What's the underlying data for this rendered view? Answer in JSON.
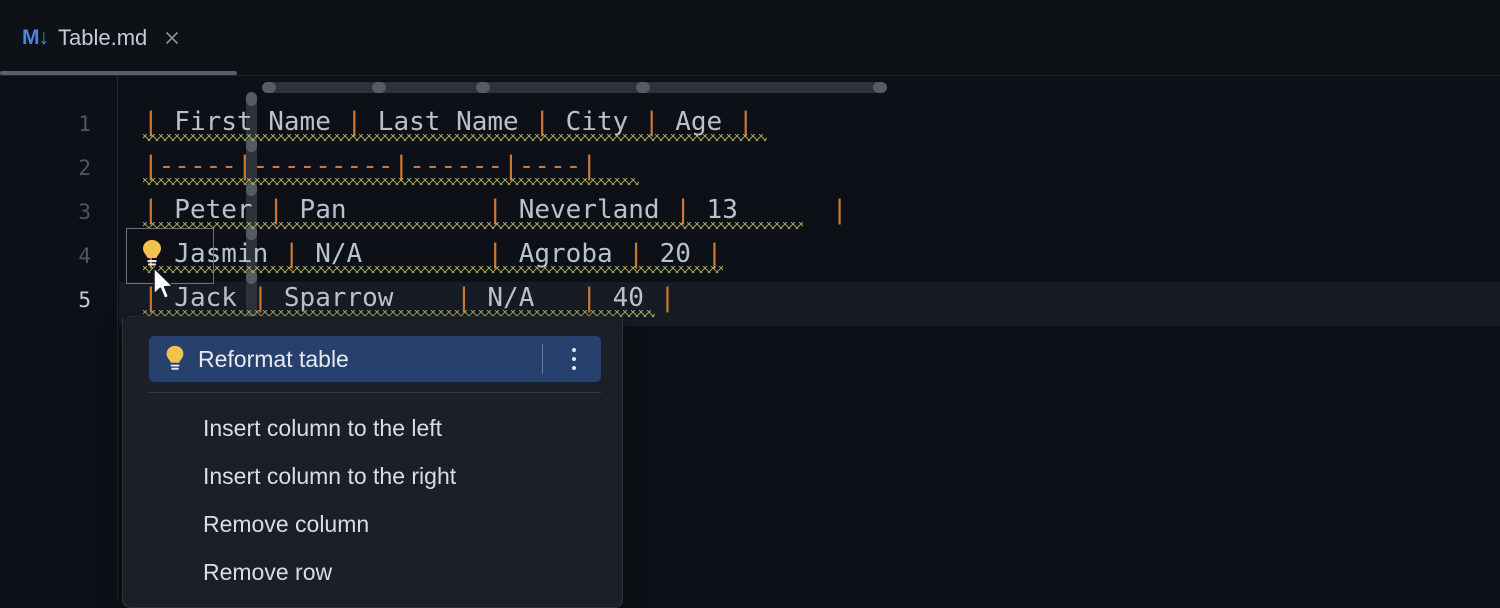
{
  "window": {
    "theme_background": "#0d1117",
    "accent_selected": "#27406e"
  },
  "tab": {
    "icon_name": "markdown-file-icon",
    "icon_glyph": "M↓",
    "title": "Table.md",
    "close_label": "×"
  },
  "editor": {
    "gutter_line_numbers": [
      "1",
      "2",
      "3",
      "4",
      "5"
    ],
    "current_line": "5",
    "lines": [
      {
        "number": "1",
        "text": "| First Name | Last Name | City | Age |",
        "tokens": [
          {
            "t": "|",
            "k": "pipe"
          },
          {
            "t": " First Name ",
            "k": "txt"
          },
          {
            "t": "|",
            "k": "pipe"
          },
          {
            "t": " Last Name ",
            "k": "txt"
          },
          {
            "t": "|",
            "k": "pipe"
          },
          {
            "t": " City ",
            "k": "txt"
          },
          {
            "t": "|",
            "k": "pipe"
          },
          {
            "t": " Age ",
            "k": "txt"
          },
          {
            "t": "|",
            "k": "pipe"
          }
        ]
      },
      {
        "number": "2",
        "text": "|-----|---------|------|----|",
        "tokens": [
          {
            "t": "|",
            "k": "pipe"
          },
          {
            "t": "-----",
            "k": "dash"
          },
          {
            "t": "|",
            "k": "pipe"
          },
          {
            "t": "---------",
            "k": "dash"
          },
          {
            "t": "|",
            "k": "pipe"
          },
          {
            "t": "------",
            "k": "dash"
          },
          {
            "t": "|",
            "k": "pipe"
          },
          {
            "t": "----",
            "k": "dash"
          },
          {
            "t": "|",
            "k": "pipe"
          }
        ]
      },
      {
        "number": "3",
        "text": "| Peter | Pan      | Neverland | 13     |",
        "tokens": [
          {
            "t": "|",
            "k": "pipe"
          },
          {
            "t": " Peter ",
            "k": "txt"
          },
          {
            "t": "|",
            "k": "pipe"
          },
          {
            "t": " Pan         ",
            "k": "txt"
          },
          {
            "t": "|",
            "k": "pipe"
          },
          {
            "t": " Neverland ",
            "k": "txt"
          },
          {
            "t": "|",
            "k": "pipe"
          },
          {
            "t": " 13      ",
            "k": "txt"
          },
          {
            "t": "|",
            "k": "pipe"
          }
        ]
      },
      {
        "number": "4",
        "text": "| Jasmin | N/A      | Agroba | 20 |",
        "tokens": [
          {
            "t": "|",
            "k": "pipe"
          },
          {
            "t": " Jasmin ",
            "k": "txt"
          },
          {
            "t": "|",
            "k": "pipe"
          },
          {
            "t": " N/A        ",
            "k": "txt"
          },
          {
            "t": "|",
            "k": "pipe"
          },
          {
            "t": " Agroba ",
            "k": "txt"
          },
          {
            "t": "|",
            "k": "pipe"
          },
          {
            "t": " 20 ",
            "k": "txt"
          },
          {
            "t": "|",
            "k": "pipe"
          }
        ]
      },
      {
        "number": "5",
        "text": "| Jack | Sparrow   | N/A   | 40 |",
        "tokens": [
          {
            "t": "|",
            "k": "pipe"
          },
          {
            "t": " Jack ",
            "k": "txt"
          },
          {
            "t": "|",
            "k": "pipe"
          },
          {
            "t": " Sparrow    ",
            "k": "txt"
          },
          {
            "t": "|",
            "k": "pipe"
          },
          {
            "t": " N/A   ",
            "k": "txt"
          },
          {
            "t": "|",
            "k": "pipe"
          },
          {
            "t": " 40 ",
            "k": "txt"
          },
          {
            "t": "|",
            "k": "pipe"
          }
        ]
      }
    ],
    "table": {
      "headers": [
        "First Name",
        "Last Name",
        "City",
        "Age"
      ],
      "rows": [
        [
          "Peter",
          "Pan",
          "Neverland",
          "13"
        ],
        [
          "Jasmin",
          "N/A",
          "Agroba",
          "20"
        ],
        [
          "Jack",
          "Sparrow",
          "N/A",
          "40"
        ]
      ]
    },
    "syntax_colors": {
      "pipe": "#cc7832",
      "text": "#b9c2cc",
      "squiggle": "#b8b858",
      "line_number": "#4f565f"
    }
  },
  "table_controls": {
    "column_bar_name": "column-resize-bar",
    "column_handles": 5,
    "row_bar_name": "row-resize-bar",
    "row_handles": 6
  },
  "intention": {
    "bulb_icon_name": "intention-bulb-icon",
    "bulb_color": "#f2c14e"
  },
  "menu": {
    "header": {
      "icon_name": "intention-bulb-icon",
      "label": "Reformat table",
      "more_icon_name": "more-vertical-icon"
    },
    "items": [
      {
        "label": "Insert column to the left"
      },
      {
        "label": "Insert column to the right"
      },
      {
        "label": "Remove column"
      },
      {
        "label": "Remove row"
      }
    ]
  },
  "pointer": {
    "icon_name": "mouse-pointer-cursor"
  }
}
